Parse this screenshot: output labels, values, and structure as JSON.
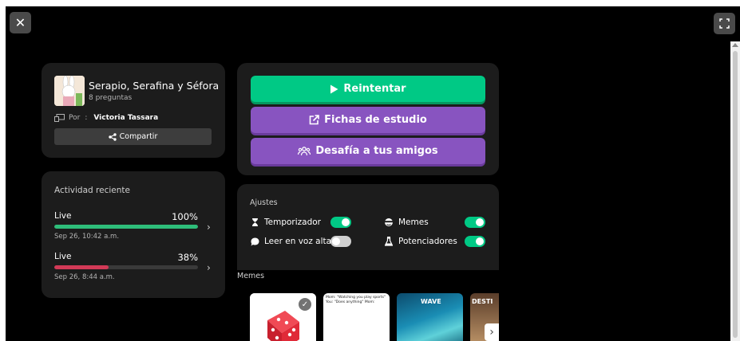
{
  "window": {
    "close_icon": "close-icon",
    "fullscreen_icon": "fullscreen-icon"
  },
  "quiz": {
    "title": "Serapio, Serafina y Séfora",
    "question_count": "8 preguntas",
    "author_prefix": "Por",
    "author_sep": ":",
    "author": "Victoria Tassara",
    "share_label": "Compartir"
  },
  "activity": {
    "title": "Actividad reciente",
    "items": [
      {
        "label": "Live",
        "percent": "100%",
        "progress": 1.0,
        "date": "Sep 26, 10:42 a.m.",
        "color": "#2ebd7a"
      },
      {
        "label": "Live",
        "percent": "38%",
        "progress": 0.38,
        "date": "Sep 26, 8:44 a.m.",
        "color": "#d23a57"
      }
    ]
  },
  "actions": {
    "retry": "Reintentar",
    "flashcards": "Fichas de estudio",
    "challenge": "Desafía a tus amigos"
  },
  "settings": {
    "title": "Ajustes",
    "items": [
      {
        "label": "Temporizador",
        "icon": "timer-icon",
        "on": true
      },
      {
        "label": "Memes",
        "icon": "memes-icon",
        "on": true
      },
      {
        "label": "Leer en voz alta",
        "icon": "speech-icon",
        "on": false
      },
      {
        "label": "Potenciadores",
        "icon": "powerups-icon",
        "on": true
      }
    ]
  },
  "memes": {
    "title": "Memes",
    "items": [
      {
        "name": "dice-meme",
        "selected": true
      },
      {
        "name": "chess-meme",
        "caption": "Mom: \"Watching you play sports\" You: \"Does anything\" Mom:"
      },
      {
        "name": "wave-meme",
        "caption": "WAVE"
      },
      {
        "name": "other-meme",
        "caption": "DESTI"
      }
    ]
  },
  "colors": {
    "green": "#00c985",
    "purple": "#8854c0",
    "panel": "#1c1c1c"
  }
}
